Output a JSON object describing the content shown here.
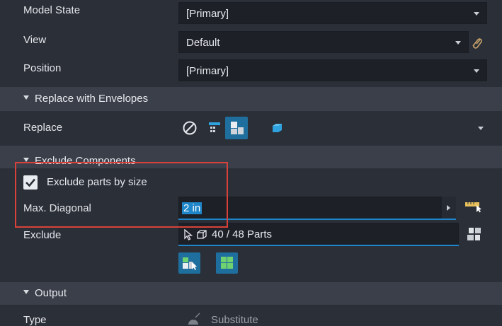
{
  "properties": {
    "model_state": {
      "label": "Model State",
      "value": "[Primary]"
    },
    "view": {
      "label": "View",
      "value": "Default"
    },
    "position": {
      "label": "Position",
      "value": "[Primary]"
    }
  },
  "sections": {
    "replace_with_envelopes": "Replace with Envelopes",
    "exclude_components": "Exclude Components",
    "output": "Output"
  },
  "replace": {
    "label": "Replace"
  },
  "exclude_components": {
    "exclude_parts_by_size": {
      "label": "Exclude parts by size",
      "checked": true
    },
    "max_diagonal": {
      "label": "Max. Diagonal",
      "value": "2 in"
    },
    "exclude": {
      "label": "Exclude",
      "count": "40 / 48 Parts"
    }
  },
  "output": {
    "type": {
      "label": "Type",
      "value": "Substitute"
    }
  },
  "colors": {
    "background": "#2b2f38",
    "field": "#1d2027",
    "section": "#3a3f4a",
    "accent_blue": "#1f86c9",
    "highlight": "#d9423a"
  }
}
